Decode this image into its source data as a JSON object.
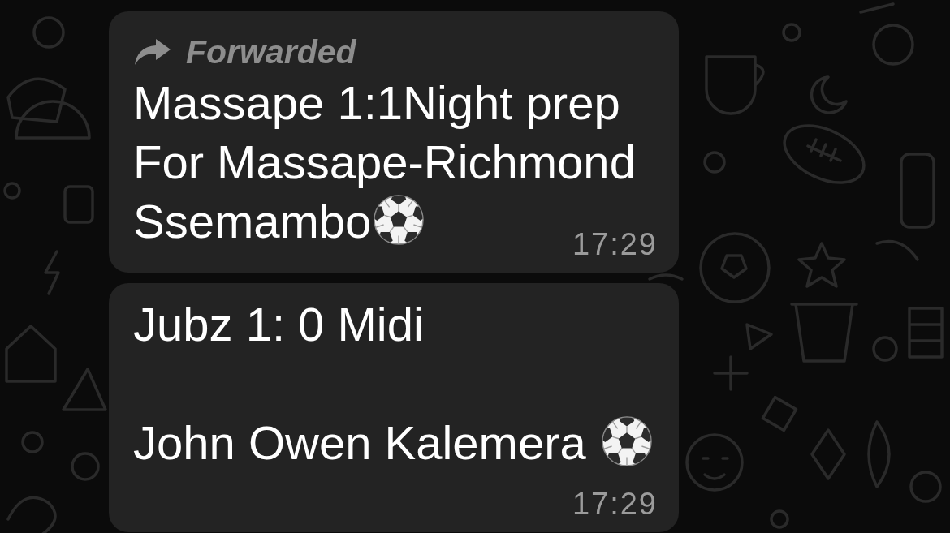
{
  "messages": [
    {
      "forwarded": true,
      "forwarded_label": "Forwarded",
      "paragraphs": [
        {
          "lines": [
            {
              "text": "Massape 1:1Night prep",
              "emoji_after": false
            },
            {
              "text": "For Massape-Richmond",
              "emoji_after": false
            },
            {
              "text": "Ssemambo",
              "emoji_after": true
            }
          ]
        }
      ],
      "time": "17:29"
    },
    {
      "forwarded": false,
      "paragraphs": [
        {
          "lines": [
            {
              "text": "Jubz 1: 0 Midi",
              "emoji_after": false
            }
          ]
        },
        {
          "lines": [
            {
              "text": "John Owen Kalemera ",
              "emoji_after": true
            }
          ]
        }
      ],
      "time": "17:29"
    }
  ]
}
